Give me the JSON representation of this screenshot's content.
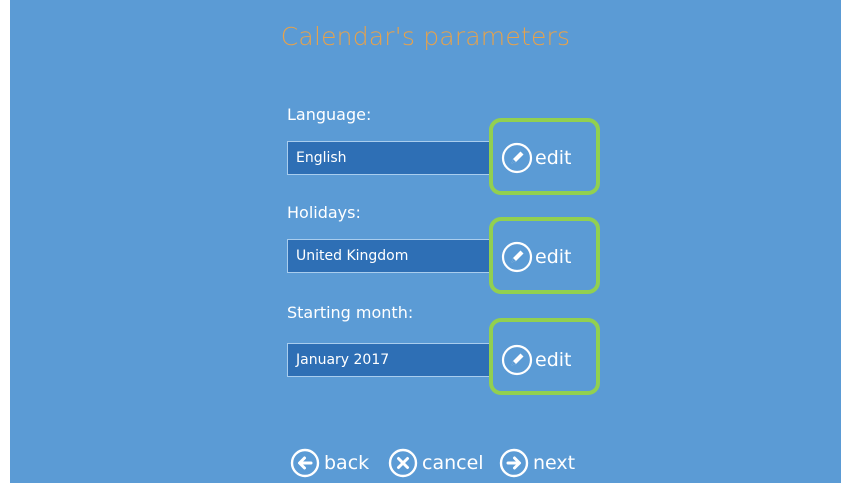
{
  "title": "Calendar's parameters",
  "fields": [
    {
      "label": "Language:",
      "value": "English",
      "edit_label": "edit"
    },
    {
      "label": "Holidays:",
      "value": "United Kingdom",
      "edit_label": "edit"
    },
    {
      "label": "Starting month:",
      "value": "January 2017",
      "edit_label": "edit"
    }
  ],
  "nav": {
    "back_label": "back",
    "cancel_label": "cancel",
    "next_label": "next"
  },
  "colors": {
    "background": "#5b9bd5",
    "title": "#e8a24a",
    "field_bg": "#2e6fb5",
    "highlight": "#92d050"
  },
  "icons": {
    "edit": "pencil-circle-icon",
    "back": "arrow-left-circle-icon",
    "cancel": "x-circle-icon",
    "next": "arrow-right-circle-icon"
  }
}
